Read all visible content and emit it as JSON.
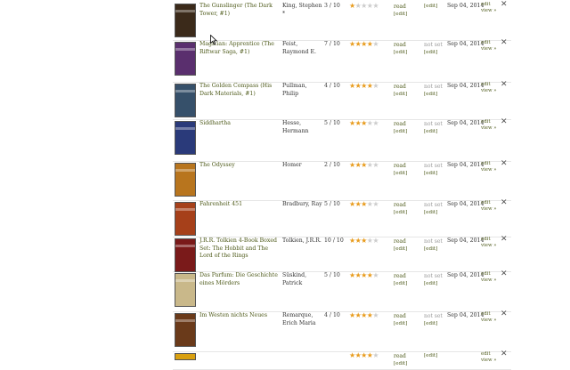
{
  "labels": {
    "read": "read",
    "not_set": "not set",
    "edit": "[edit]",
    "edit2": "edit",
    "view": "view »",
    "close": "✕"
  },
  "books": [
    {
      "title": "The Gunslinger (The Dark Tower, #1)",
      "author": "King, Stephen *",
      "rating": "3 / 10",
      "stars": 1,
      "read": "",
      "date": "Sep 04, 2014",
      "cover": "#3b2a1a"
    },
    {
      "title": "Magician: Apprentice (The Riftwar Saga, #1)",
      "author": "Feist, Raymond E.",
      "rating": "7 / 10",
      "stars": 4,
      "read": "not set",
      "date": "Sep 04, 2014",
      "cover": "#5a2f6e"
    },
    {
      "title": "The Golden Compass (His Dark Materials, #1)",
      "author": "Pullman, Philip",
      "rating": "4 / 10",
      "stars": 4,
      "read": "not set",
      "date": "Sep 04, 2014",
      "cover": "#36506a"
    },
    {
      "title": "Siddhartha",
      "author": "Hesse, Hermann",
      "rating": "5 / 10",
      "stars": 3,
      "read": "not set",
      "date": "Sep 04, 2014",
      "cover": "#2a3a7a"
    },
    {
      "title": "The Odyssey",
      "author": "Homer",
      "rating": "2 / 10",
      "stars": 3,
      "read": "not set",
      "date": "Sep 04, 2014",
      "cover": "#b8751e"
    },
    {
      "title": "Fahrenheit 451",
      "author": "Bradbury, Ray",
      "rating": "5 / 10",
      "stars": 3,
      "read": "not set",
      "date": "Sep 04, 2014",
      "cover": "#a6401a"
    },
    {
      "title": "J.R.R. Tolkien 4-Book Boxed Set: The Hobbit and The Lord of the Rings",
      "author": "Tolkien, J.R.R.",
      "rating": "10 / 10",
      "stars": 3,
      "read": "not set",
      "date": "Sep 04, 2014",
      "cover": "#7a1a1a"
    },
    {
      "title": "Das Parfum: Die Geschichte eines Mörders",
      "author": "Süskind, Patrick",
      "rating": "5 / 10",
      "stars": 4,
      "read": "not set",
      "date": "Sep 04, 2014",
      "cover": "#c9b88a"
    },
    {
      "title": "Im Westen nichts Neues",
      "author": "Remarque, Erich Maria",
      "rating": "4 / 10",
      "stars": 4,
      "read": "not set",
      "date": "Sep 04, 2014",
      "cover": "#6a3a1a"
    },
    {
      "title": "",
      "author": "",
      "rating": "",
      "stars": 4,
      "read": "",
      "date": "",
      "cover": "#d9a010"
    }
  ]
}
